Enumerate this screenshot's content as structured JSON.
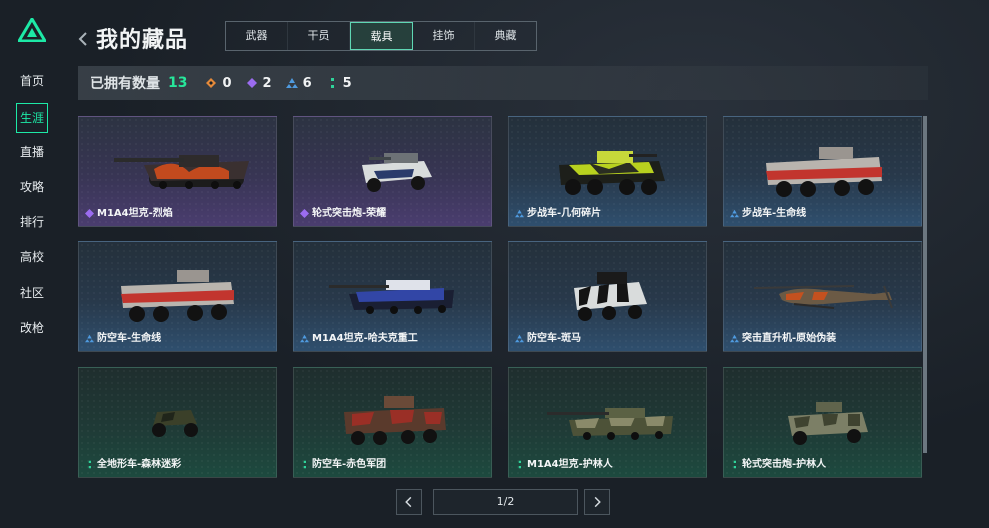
{
  "sidebar": {
    "items": [
      {
        "label": "首页",
        "active": false
      },
      {
        "label": "生涯",
        "active": true
      },
      {
        "label": "直播",
        "active": false
      },
      {
        "label": "攻略",
        "active": false
      },
      {
        "label": "排行",
        "active": false
      },
      {
        "label": "高校",
        "active": false
      },
      {
        "label": "社区",
        "active": false
      },
      {
        "label": "改枪",
        "active": false
      }
    ]
  },
  "header": {
    "title": "我的藏品",
    "tabs": [
      {
        "label": "武器",
        "active": false
      },
      {
        "label": "干员",
        "active": false
      },
      {
        "label": "载具",
        "active": true
      },
      {
        "label": "挂饰",
        "active": false
      },
      {
        "label": "典藏",
        "active": false
      }
    ]
  },
  "summary": {
    "label": "已拥有数量",
    "total": "13",
    "rarities": [
      {
        "icon": "orange-diamond-icon",
        "color": "#e58a3a",
        "count": "0"
      },
      {
        "icon": "purple-diamond-icon",
        "color": "#9b6cf0",
        "count": "2"
      },
      {
        "icon": "blue-triangle-icon",
        "color": "#4f9be0",
        "count": "6"
      },
      {
        "icon": "green-dots-icon",
        "color": "#2fd39a",
        "count": "5"
      }
    ]
  },
  "cards": [
    {
      "name": "M1A4坦克-烈焰",
      "rarity": "purple"
    },
    {
      "name": "轮式突击炮-荣耀",
      "rarity": "purple"
    },
    {
      "name": "步战车-几何碎片",
      "rarity": "blue"
    },
    {
      "name": "步战车-生命线",
      "rarity": "blue"
    },
    {
      "name": "防空车-生命线",
      "rarity": "blue"
    },
    {
      "name": "M1A4坦克-哈夫克重工",
      "rarity": "blue"
    },
    {
      "name": "防空车-斑马",
      "rarity": "blue"
    },
    {
      "name": "突击直升机-原始伪装",
      "rarity": "blue"
    },
    {
      "name": "全地形车-森林迷彩",
      "rarity": "green"
    },
    {
      "name": "防空车-赤色军团",
      "rarity": "green"
    },
    {
      "name": "M1A4坦克-护林人",
      "rarity": "green"
    },
    {
      "name": "轮式突击炮-护林人",
      "rarity": "green"
    }
  ],
  "pagination": {
    "page": "1/2"
  },
  "colors": {
    "accent": "#1de9a6",
    "background": "#1a2027"
  }
}
